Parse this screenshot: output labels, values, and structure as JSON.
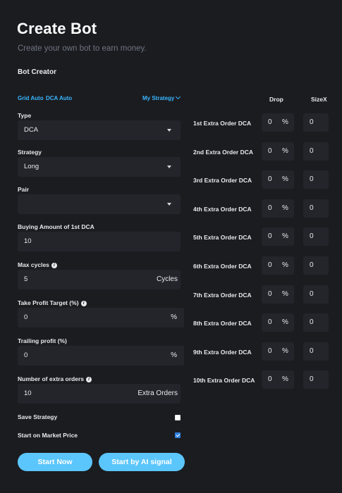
{
  "header": {
    "title": "Create Bot",
    "subtitle": "Create your own bot to earn money."
  },
  "section_title": "Bot Creator",
  "tabs": {
    "grid_auto": "Grid Auto",
    "dca_auto": "DCA Auto",
    "my_strategy": "My Strategy"
  },
  "form": {
    "type": {
      "label": "Type",
      "value": "DCA"
    },
    "strategy": {
      "label": "Strategy",
      "value": "Long"
    },
    "pair": {
      "label": "Pair",
      "value": ""
    },
    "buying_amount": {
      "label": "Buying Amount of 1st  DCA",
      "value": "10"
    },
    "max_cycles": {
      "label": "Max cycles",
      "value": "5",
      "suffix": "Cycles"
    },
    "take_profit": {
      "label": "Take Profit Target (%)",
      "value": "0",
      "suffix": "%"
    },
    "trailing_profit": {
      "label": "Trailing profit (%)",
      "value": "0",
      "suffix": "%"
    },
    "extra_orders": {
      "label": "Number of extra orders",
      "value": "10",
      "suffix": "Extra Orders"
    },
    "save_strategy": {
      "label": "Save Strategy",
      "checked": false
    },
    "start_market": {
      "label": "Start on Market Price",
      "checked": true
    }
  },
  "buttons": {
    "start_now": "Start Now",
    "start_ai": "Start by AI signal"
  },
  "extra_table": {
    "drop_header": "Drop",
    "sizex_header": "SizeX",
    "pct_symbol": "%",
    "info_glyph": "i",
    "rows": [
      {
        "label": "1st Extra Order DCA",
        "drop": "0",
        "sizex": "0"
      },
      {
        "label": "2nd Extra Order DCA",
        "drop": "0",
        "sizex": "0"
      },
      {
        "label": "3rd Extra Order DCA",
        "drop": "0",
        "sizex": "0"
      },
      {
        "label": "4th Extra Order DCA",
        "drop": "0",
        "sizex": "0"
      },
      {
        "label": "5th Extra Order DCA",
        "drop": "0",
        "sizex": "0"
      },
      {
        "label": "6th Extra Order DCA",
        "drop": "0",
        "sizex": "0"
      },
      {
        "label": "7th Extra Order DCA",
        "drop": "0",
        "sizex": "0"
      },
      {
        "label": "8th Extra Order DCA",
        "drop": "0",
        "sizex": "0"
      },
      {
        "label": "9th Extra Order DCA",
        "drop": "0",
        "sizex": "0"
      },
      {
        "label": "10th Extra Order DCA",
        "drop": "0",
        "sizex": "0"
      }
    ]
  },
  "colors": {
    "background": "#1b1c20",
    "field": "#23252b",
    "accent": "#38b6ff",
    "button": "#5bc6fb",
    "checkbox_checked": "#2f7fe0"
  }
}
